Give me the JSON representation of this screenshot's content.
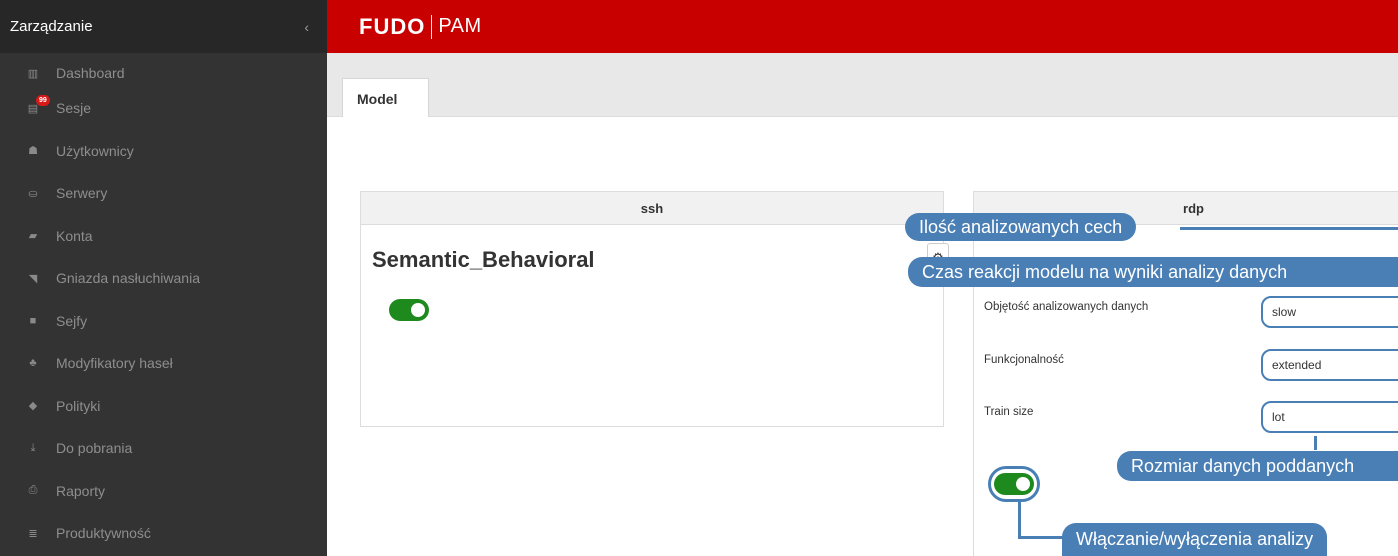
{
  "sidebar": {
    "title": "Zarządzanie",
    "collapse_glyph": "‹",
    "items": [
      {
        "label": "Dashboard",
        "icon": "bar-chart-icon",
        "glyph": "▥"
      },
      {
        "label": "Sesje",
        "icon": "film-icon",
        "glyph": "▤",
        "badge": "99"
      },
      {
        "label": "Użytkownicy",
        "icon": "users-icon",
        "glyph": "☗"
      },
      {
        "label": "Serwery",
        "icon": "server-icon",
        "glyph": "⛀"
      },
      {
        "label": "Konta",
        "icon": "book-icon",
        "glyph": "▰"
      },
      {
        "label": "Gniazda nasłuchiwania",
        "icon": "rss-icon",
        "glyph": "◥"
      },
      {
        "label": "Sejfy",
        "icon": "safe-icon",
        "glyph": "■"
      },
      {
        "label": "Modyfikatory haseł",
        "icon": "sitemap-icon",
        "glyph": "♣"
      },
      {
        "label": "Polityki",
        "icon": "shield-icon",
        "glyph": "◆"
      },
      {
        "label": "Do pobrania",
        "icon": "download-icon",
        "glyph": "⤓"
      },
      {
        "label": "Raporty",
        "icon": "print-icon",
        "glyph": "⎙"
      },
      {
        "label": "Produktywność",
        "icon": "list-icon",
        "glyph": "≣"
      }
    ]
  },
  "header": {
    "logo_fudo": "FUDO",
    "logo_pam": "PAM",
    "color": "#c90000"
  },
  "tabs": [
    {
      "label": "Model"
    }
  ],
  "panels": {
    "ssh": {
      "title": "ssh",
      "model_name": "Semantic_Behavioral",
      "gear_glyph": "⚙",
      "enabled": true
    },
    "rdp": {
      "title": "rdp",
      "fields": [
        {
          "label": "Objętość analizowanych danych",
          "value": "slow"
        },
        {
          "label": "Funkcjonalność",
          "value": "extended"
        },
        {
          "label": "Train size",
          "value": "lot"
        }
      ],
      "enabled": true
    }
  },
  "callouts": {
    "features": "Ilość analizowanych cech",
    "reaction": "Czas reakcji modelu na wyniki analizy danych",
    "train": "Rozmiar danych poddanych",
    "toggle": "Włączanie/wyłączenia analizy"
  },
  "colors": {
    "accent": "#4a7fb5",
    "toggle_on": "#1e8a1e",
    "sidebar_bg": "#333333"
  }
}
